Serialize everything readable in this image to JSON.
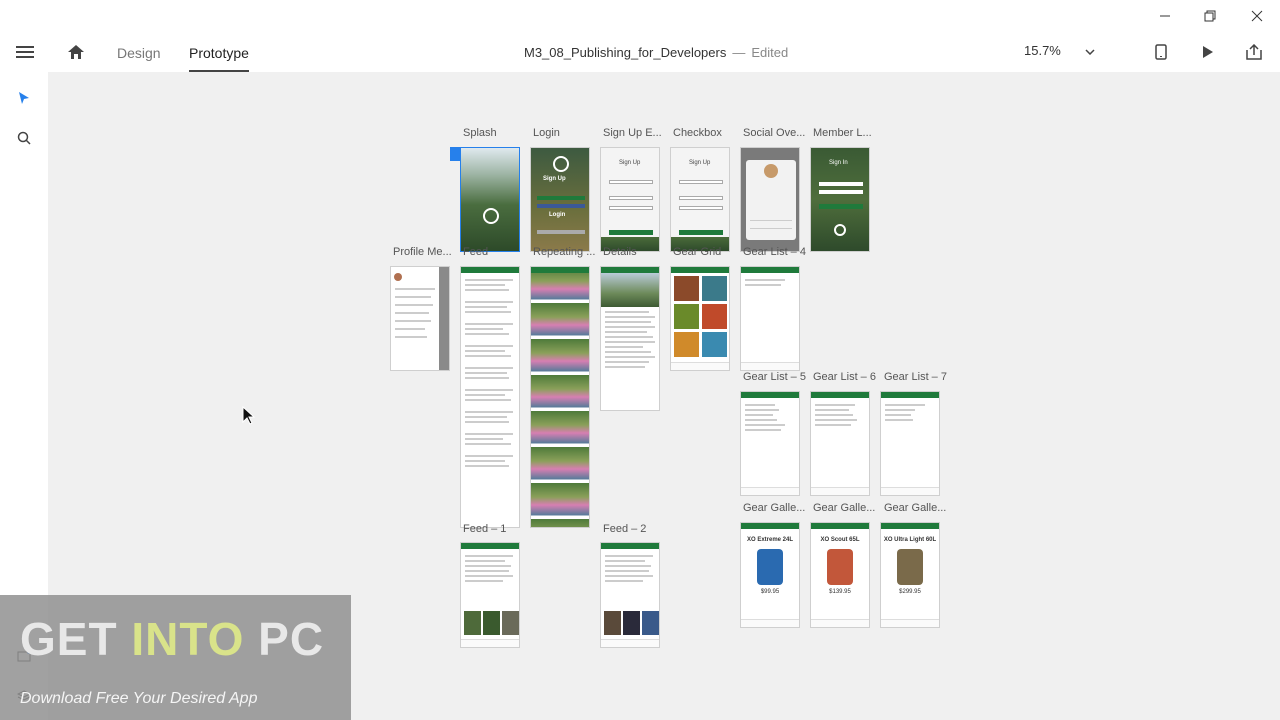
{
  "app": {
    "tabs": {
      "design": "Design",
      "prototype": "Prototype"
    },
    "doc_title": "M3_08_Publishing_for_Developers",
    "doc_sep": "—",
    "doc_status": "Edited",
    "zoom": "15.7%"
  },
  "artboards": {
    "splash": "Splash",
    "login": "Login",
    "signup_e": "Sign Up E...",
    "checkbox": "Checkbox",
    "social": "Social Ove...",
    "member": "Member L...",
    "profile": "Profile Me...",
    "feed": "Feed",
    "repeating": "Repeating ...",
    "details": "Details",
    "gear_grid": "Gear Grid",
    "gear_list_4": "Gear List – 4",
    "gear_list_5": "Gear List – 5",
    "gear_list_6": "Gear List – 6",
    "gear_list_7": "Gear List – 7",
    "feed_1": "Feed – 1",
    "feed_2": "Feed – 2",
    "gear_gallery_1": "Gear Galle...",
    "gear_gallery_2": "Gear Galle...",
    "gear_gallery_3": "Gear Galle..."
  },
  "thumb_text": {
    "signup": "Sign Up",
    "sign_in": "Sign In",
    "login": "Login",
    "gallery_1_title": "XO Extreme 24L",
    "gallery_1_price": "$99.95",
    "gallery_2_title": "XO Scout 65L",
    "gallery_2_price": "$139.95",
    "gallery_3_title": "XO Ultra Light 60L",
    "gallery_3_price": "$299.95"
  },
  "watermark": {
    "title_a": "GET ",
    "title_b": "INTO",
    "title_c": " PC",
    "subtitle": "Download Free Your Desired App"
  },
  "colors": {
    "brand_green": "#1f7a3b",
    "accent_blue": "#2680eb"
  }
}
